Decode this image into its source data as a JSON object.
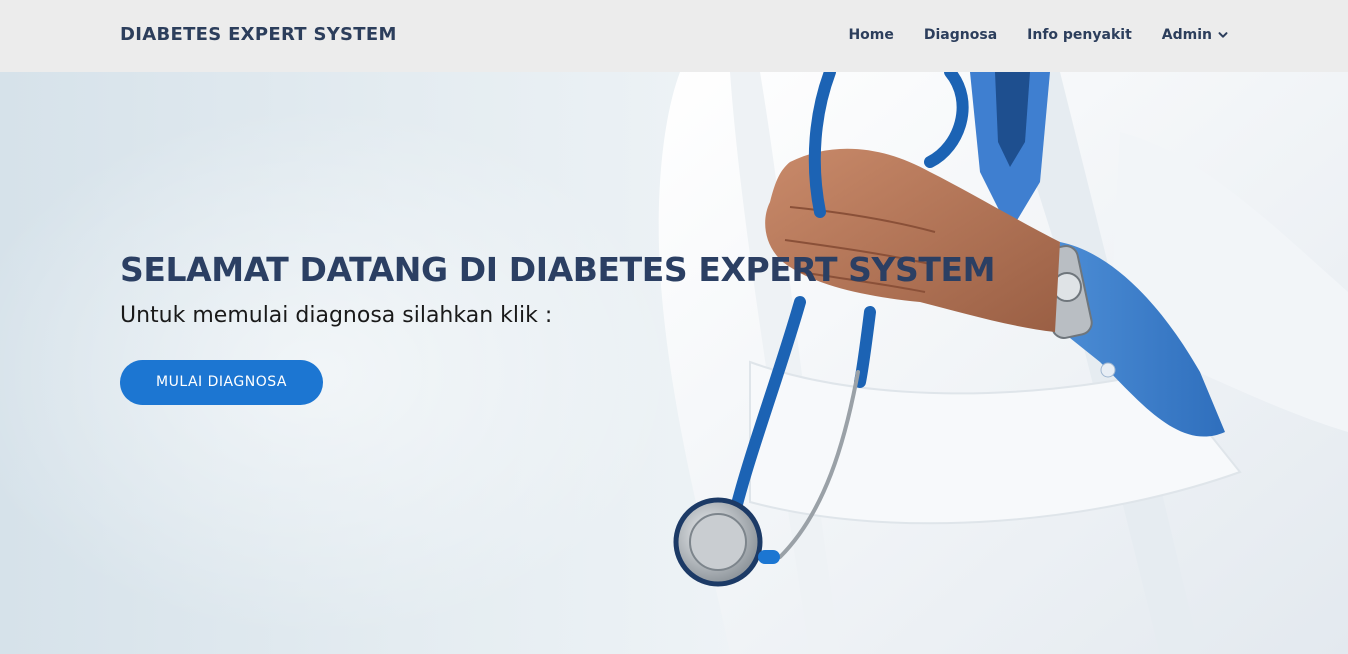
{
  "navbar": {
    "brand": "DIABETES EXPERT SYSTEM",
    "items": [
      {
        "label": "Home"
      },
      {
        "label": "Diagnosa"
      },
      {
        "label": "Info penyakit"
      },
      {
        "label": "Admin",
        "icon": "chevron-down-icon"
      }
    ]
  },
  "hero": {
    "title": "SELAMAT DATANG DI DIABETES EXPERT SYSTEM",
    "subtitle": "Untuk memulai diagnosa silahkan klik :",
    "cta_label": "MULAI DIAGNOSA",
    "image": "doctor-with-stethoscope"
  },
  "colors": {
    "brand": "#2c3e5c",
    "title": "#2b3f63",
    "accent": "#1c76d2",
    "navbar_bg": "#ececec"
  }
}
